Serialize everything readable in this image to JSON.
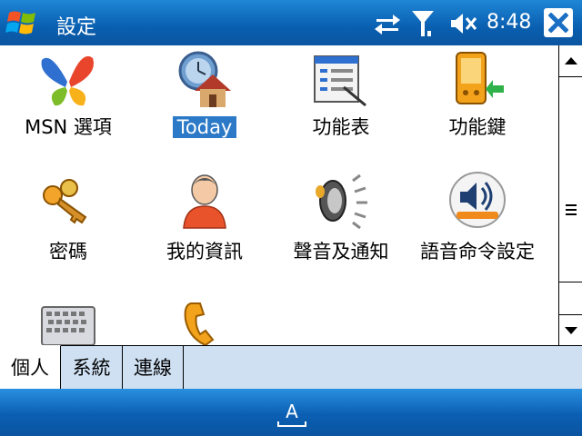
{
  "titlebar": {
    "title": "設定",
    "clock": "8:48",
    "start_icon": "windows-flag-icon",
    "icons": [
      "sync-arrows-icon",
      "signal-antenna-icon",
      "speaker-muted-icon",
      "close-x-icon"
    ]
  },
  "items": [
    {
      "label": "MSN 選項",
      "icon": "msn-butterfly-icon",
      "selected": false
    },
    {
      "label": "Today",
      "icon": "today-house-clock-icon",
      "selected": true
    },
    {
      "label": "功能表",
      "icon": "menu-window-icon",
      "selected": false
    },
    {
      "label": "功能鍵",
      "icon": "pda-buttons-icon",
      "selected": false
    },
    {
      "label": "密碼",
      "icon": "keys-icon",
      "selected": false
    },
    {
      "label": "我的資訊",
      "icon": "user-person-icon",
      "selected": false
    },
    {
      "label": "聲音及通知",
      "icon": "speaker-sound-icon",
      "selected": false
    },
    {
      "label": "語音命令設定",
      "icon": "voice-command-icon",
      "selected": false
    },
    {
      "label": "",
      "icon": "keyboard-input-icon",
      "selected": false
    },
    {
      "label": "",
      "icon": "phone-handset-icon",
      "selected": false
    }
  ],
  "tabs": [
    {
      "label": "個人",
      "active": true
    },
    {
      "label": "系統",
      "active": false
    },
    {
      "label": "連線",
      "active": false
    }
  ],
  "bottombar": {
    "icon": "soft-input-keyboard-icon",
    "glyph": "A"
  },
  "colors": {
    "titlebar": "#0a5fb0",
    "selection": "#2b79c7",
    "tabstrip": "#cfe0f3"
  }
}
